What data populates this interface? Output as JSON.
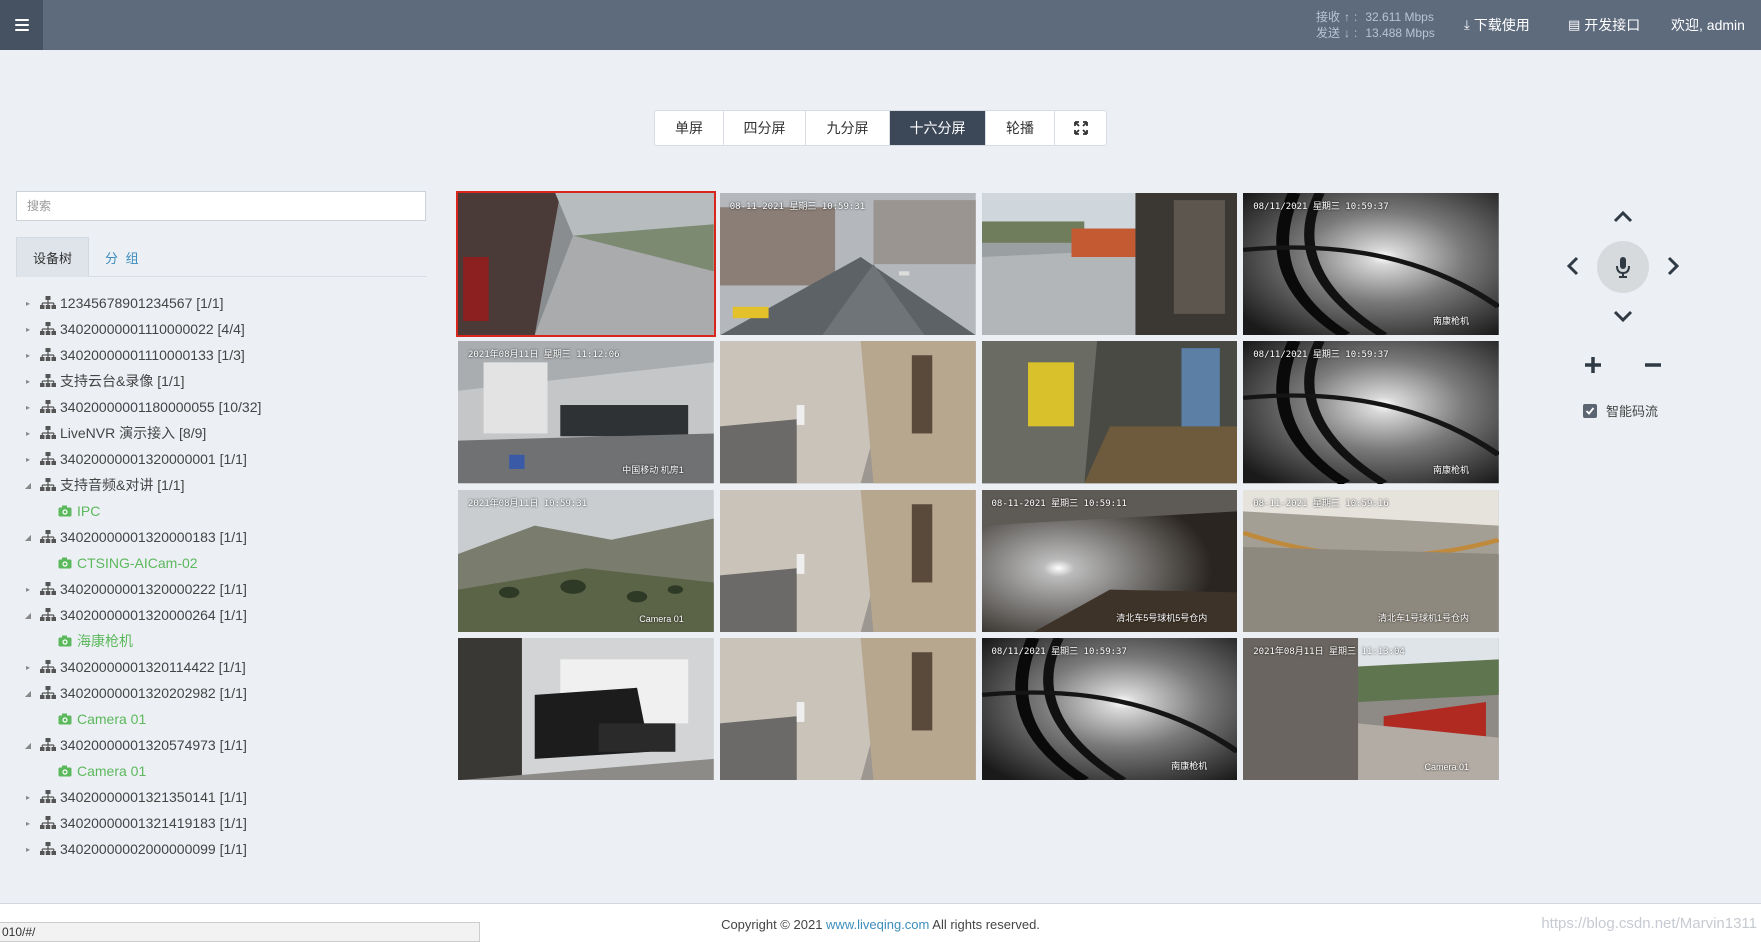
{
  "header": {
    "receive_label": "接收",
    "receive_rate": "32.611 Mbps",
    "send_label": "发送",
    "send_rate": "13.488 Mbps",
    "download_label": "下载使用",
    "api_label": "开发接口",
    "welcome": "欢迎, admin"
  },
  "split": {
    "buttons": [
      "单屏",
      "四分屏",
      "九分屏",
      "十六分屏",
      "轮播"
    ],
    "active": "十六分屏"
  },
  "search": {
    "placeholder": "搜索"
  },
  "tabs": {
    "device_tree": "设备树",
    "group": "分 组"
  },
  "tree": [
    {
      "label": "12345678901234567 [1/1]",
      "expanded": false
    },
    {
      "label": "34020000001110000022 [4/4]",
      "expanded": false
    },
    {
      "label": "34020000001110000133 [1/3]",
      "expanded": false
    },
    {
      "label": "支持云台&录像 [1/1]",
      "expanded": false
    },
    {
      "label": "34020000001180000055 [10/32]",
      "expanded": false
    },
    {
      "label": "LiveNVR 演示接入 [8/9]",
      "expanded": false
    },
    {
      "label": "34020000001320000001 [1/1]",
      "expanded": false
    },
    {
      "label": "支持音频&对讲 [1/1]",
      "expanded": true
    },
    {
      "label": "IPC",
      "child": true
    },
    {
      "label": "34020000001320000183 [1/1]",
      "expanded": true
    },
    {
      "label": "CTSING-AICam-02",
      "child": true
    },
    {
      "label": "34020000001320000222 [1/1]",
      "expanded": false
    },
    {
      "label": "34020000001320000264 [1/1]",
      "expanded": true
    },
    {
      "label": "海康枪机",
      "child": true
    },
    {
      "label": "34020000001320114422 [1/1]",
      "expanded": false
    },
    {
      "label": "34020000001320202982 [1/1]",
      "expanded": true
    },
    {
      "label": "Camera 01",
      "child": true
    },
    {
      "label": "34020000001320574973 [1/1]",
      "expanded": true
    },
    {
      "label": "Camera 01",
      "child": true
    },
    {
      "label": "34020000001321350141 [1/1]",
      "expanded": false
    },
    {
      "label": "34020000001321419183 [1/1]",
      "expanded": false
    },
    {
      "label": "34020000002000000099 [1/1]",
      "expanded": false
    }
  ],
  "videos": [
    {
      "scene": "street",
      "ts": "",
      "cap": ""
    },
    {
      "scene": "city",
      "ts": "08-11-2021 星期三 10:59:31",
      "cap": ""
    },
    {
      "scene": "yard",
      "ts": "",
      "cap": ""
    },
    {
      "scene": "ir",
      "ts": "08/11/2021 星期三 10:59:37",
      "cap": "南康枪机"
    },
    {
      "scene": "room",
      "ts": "2021年08月11日 星期三 11:12:06",
      "cap": "中国移动 机房1"
    },
    {
      "scene": "box",
      "ts": "",
      "cap": ""
    },
    {
      "scene": "elevator",
      "ts": "",
      "cap": ""
    },
    {
      "scene": "ir",
      "ts": "08/11/2021 星期三 10:59:37",
      "cap": "南康枪机"
    },
    {
      "scene": "hill",
      "ts": "2021年08月11日 10:59:31",
      "cap": "Camera 01"
    },
    {
      "scene": "box",
      "ts": "",
      "cap": ""
    },
    {
      "scene": "dark",
      "ts": "08-11-2021 星期三 10:59:11",
      "cap": "清北车5号球机5号仓内"
    },
    {
      "scene": "tunnel",
      "ts": "08-11-2021 星期三 10:59:16",
      "cap": "清北车1号球机1号仓内"
    },
    {
      "scene": "office",
      "ts": "",
      "cap": ""
    },
    {
      "scene": "box",
      "ts": "",
      "cap": ""
    },
    {
      "scene": "ir",
      "ts": "08/11/2021 星期三 10:59:37",
      "cap": "南康枪机"
    },
    {
      "scene": "truck",
      "ts": "2021年08月11日 星期三 11:13:04",
      "cap": "Camera 01"
    }
  ],
  "ptz": {
    "smart_stream_label": "智能码流",
    "smart_stream_checked": true
  },
  "footer": {
    "copyright_prefix": "Copyright © 2021 ",
    "link_text": "www.liveqing.com",
    "copyright_suffix": " All rights reserved.",
    "status_url": "010/#/",
    "watermark": "https://blog.csdn.net/Marvin1311"
  },
  "colors": {
    "header": "#5e6b7d",
    "active_button": "#3c4758",
    "selected_border": "#d9261c",
    "link": "#3c8dbc",
    "online": "#5cb85c"
  }
}
